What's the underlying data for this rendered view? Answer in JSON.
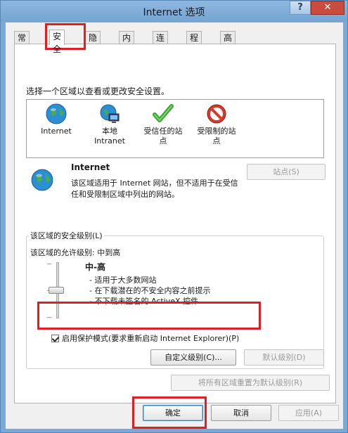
{
  "window": {
    "title": "Internet 选项",
    "help": "?",
    "close": "✕"
  },
  "tabs": [
    {
      "label": "常规"
    },
    {
      "label": "安全"
    },
    {
      "label": "隐私"
    },
    {
      "label": "内容"
    },
    {
      "label": "连接"
    },
    {
      "label": "程序"
    },
    {
      "label": "高级"
    }
  ],
  "security": {
    "zone_prompt": "选择一个区域以查看或更改安全设置。",
    "zones": [
      {
        "label": "Internet",
        "icon": "globe-icon"
      },
      {
        "label": "本地\nIntranet",
        "icon": "intranet-icon"
      },
      {
        "label": "受信任的站\n点",
        "icon": "check-icon"
      },
      {
        "label": "受限制的站\n点",
        "icon": "restricted-icon"
      }
    ],
    "selected_zone": {
      "name": "Internet",
      "description": "该区域适用于 Internet 网站，但不适用于在受信任和受限制区域中列出的网站。",
      "sites_button": "站点(S)"
    },
    "level_group_title": "该区域的安全级别(L)",
    "allowed_levels": "该区域的允许级别: 中到高",
    "level": {
      "name": "中-高",
      "bullets": [
        "- 适用于大多数网站",
        "- 在下载潜在的不安全内容之前提示",
        "- 不下载未签名的 ActiveX 控件"
      ]
    },
    "protected_mode": {
      "label": "启用保护模式(要求重新启动 Internet Explorer)(P)",
      "checked": true
    },
    "custom_level_button": "自定义级别(C)...",
    "default_level_button": "默认级别(D)",
    "reset_all_button": "将所有区域重置为默认级别(R)"
  },
  "dialog_buttons": {
    "ok": "确定",
    "cancel": "取消",
    "apply": "应用(A)"
  }
}
